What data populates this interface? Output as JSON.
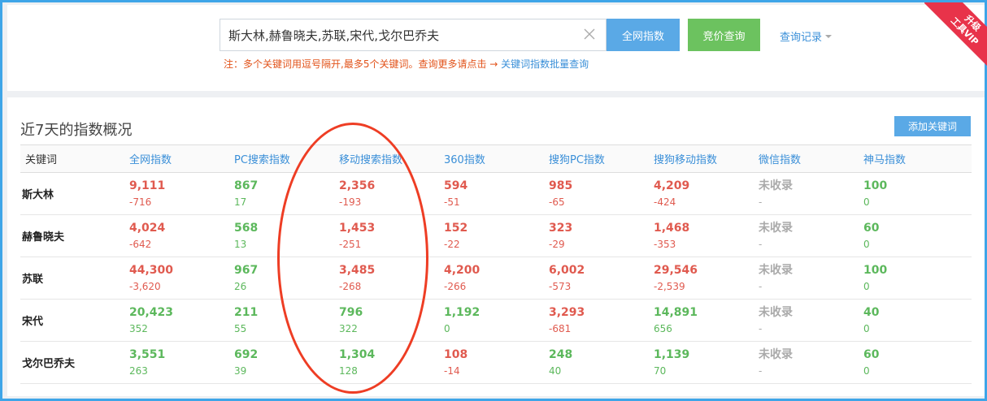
{
  "search": {
    "value": "斯大林,赫鲁晓夫,苏联,宋代,戈尔巴乔夫",
    "all_index_button": "全网指数",
    "bid_query_button": "竞价查询",
    "history_link": "查询记录",
    "note_prefix": "注：多个关键词用逗号隔开,最多5个关键词。查询更多请点击",
    "note_arrow": "→",
    "note_link": "关键词指数批量查询"
  },
  "vip": {
    "line1": "升级",
    "line2": "工具VIP"
  },
  "overview": {
    "title": "近7天的指数概况",
    "add_keyword_button": "添加关键词",
    "columns": [
      "关键词",
      "全网指数",
      "PC搜索指数",
      "移动搜索指数",
      "360指数",
      "搜狗PC指数",
      "搜狗移动指数",
      "微信指数",
      "神马指数"
    ],
    "rows": [
      {
        "keyword": "斯大林",
        "cells": [
          {
            "v": "9,111",
            "c": "-716",
            "cv": "red",
            "cc": "red"
          },
          {
            "v": "867",
            "c": "17",
            "cv": "green",
            "cc": "green"
          },
          {
            "v": "2,356",
            "c": "-193",
            "cv": "red",
            "cc": "red"
          },
          {
            "v": "594",
            "c": "-51",
            "cv": "red",
            "cc": "red"
          },
          {
            "v": "985",
            "c": "-65",
            "cv": "red",
            "cc": "red"
          },
          {
            "v": "4,209",
            "c": "-424",
            "cv": "red",
            "cc": "red"
          },
          {
            "v": "未收录",
            "c": "-",
            "cv": "gray",
            "cc": "gray"
          },
          {
            "v": "100",
            "c": "0",
            "cv": "green",
            "cc": "green"
          }
        ]
      },
      {
        "keyword": "赫鲁晓夫",
        "cells": [
          {
            "v": "4,024",
            "c": "-642",
            "cv": "red",
            "cc": "red"
          },
          {
            "v": "568",
            "c": "13",
            "cv": "green",
            "cc": "green"
          },
          {
            "v": "1,453",
            "c": "-251",
            "cv": "red",
            "cc": "red"
          },
          {
            "v": "152",
            "c": "-22",
            "cv": "red",
            "cc": "red"
          },
          {
            "v": "323",
            "c": "-29",
            "cv": "red",
            "cc": "red"
          },
          {
            "v": "1,468",
            "c": "-353",
            "cv": "red",
            "cc": "red"
          },
          {
            "v": "未收录",
            "c": "-",
            "cv": "gray",
            "cc": "gray"
          },
          {
            "v": "60",
            "c": "0",
            "cv": "green",
            "cc": "green"
          }
        ]
      },
      {
        "keyword": "苏联",
        "cells": [
          {
            "v": "44,300",
            "c": "-3,620",
            "cv": "red",
            "cc": "red"
          },
          {
            "v": "967",
            "c": "26",
            "cv": "green",
            "cc": "green"
          },
          {
            "v": "3,485",
            "c": "-268",
            "cv": "red",
            "cc": "red"
          },
          {
            "v": "4,200",
            "c": "-266",
            "cv": "red",
            "cc": "red"
          },
          {
            "v": "6,002",
            "c": "-573",
            "cv": "red",
            "cc": "red"
          },
          {
            "v": "29,546",
            "c": "-2,539",
            "cv": "red",
            "cc": "red"
          },
          {
            "v": "未收录",
            "c": "-",
            "cv": "gray",
            "cc": "gray"
          },
          {
            "v": "100",
            "c": "0",
            "cv": "green",
            "cc": "green"
          }
        ]
      },
      {
        "keyword": "宋代",
        "cells": [
          {
            "v": "20,423",
            "c": "352",
            "cv": "green",
            "cc": "green"
          },
          {
            "v": "211",
            "c": "55",
            "cv": "green",
            "cc": "green"
          },
          {
            "v": "796",
            "c": "322",
            "cv": "green",
            "cc": "green"
          },
          {
            "v": "1,192",
            "c": "0",
            "cv": "green",
            "cc": "green"
          },
          {
            "v": "3,293",
            "c": "-681",
            "cv": "red",
            "cc": "red"
          },
          {
            "v": "14,891",
            "c": "656",
            "cv": "green",
            "cc": "green"
          },
          {
            "v": "未收录",
            "c": "-",
            "cv": "gray",
            "cc": "gray"
          },
          {
            "v": "40",
            "c": "0",
            "cv": "green",
            "cc": "green"
          }
        ]
      },
      {
        "keyword": "戈尔巴乔夫",
        "cells": [
          {
            "v": "3,551",
            "c": "263",
            "cv": "green",
            "cc": "green"
          },
          {
            "v": "692",
            "c": "39",
            "cv": "green",
            "cc": "green"
          },
          {
            "v": "1,304",
            "c": "128",
            "cv": "green",
            "cc": "green"
          },
          {
            "v": "108",
            "c": "-14",
            "cv": "red",
            "cc": "red"
          },
          {
            "v": "248",
            "c": "40",
            "cv": "green",
            "cc": "green"
          },
          {
            "v": "1,139",
            "c": "70",
            "cv": "green",
            "cc": "green"
          },
          {
            "v": "未收录",
            "c": "-",
            "cv": "gray",
            "cc": "gray"
          },
          {
            "v": "60",
            "c": "0",
            "cv": "green",
            "cc": "green"
          }
        ]
      }
    ]
  },
  "colors": {
    "accent": "#5aa9e6",
    "green_button": "#6cc25f",
    "up": "#5cb85c",
    "down": "#e05a4f",
    "frame": "#3ea5e8",
    "annotation": "#ee3d24"
  }
}
